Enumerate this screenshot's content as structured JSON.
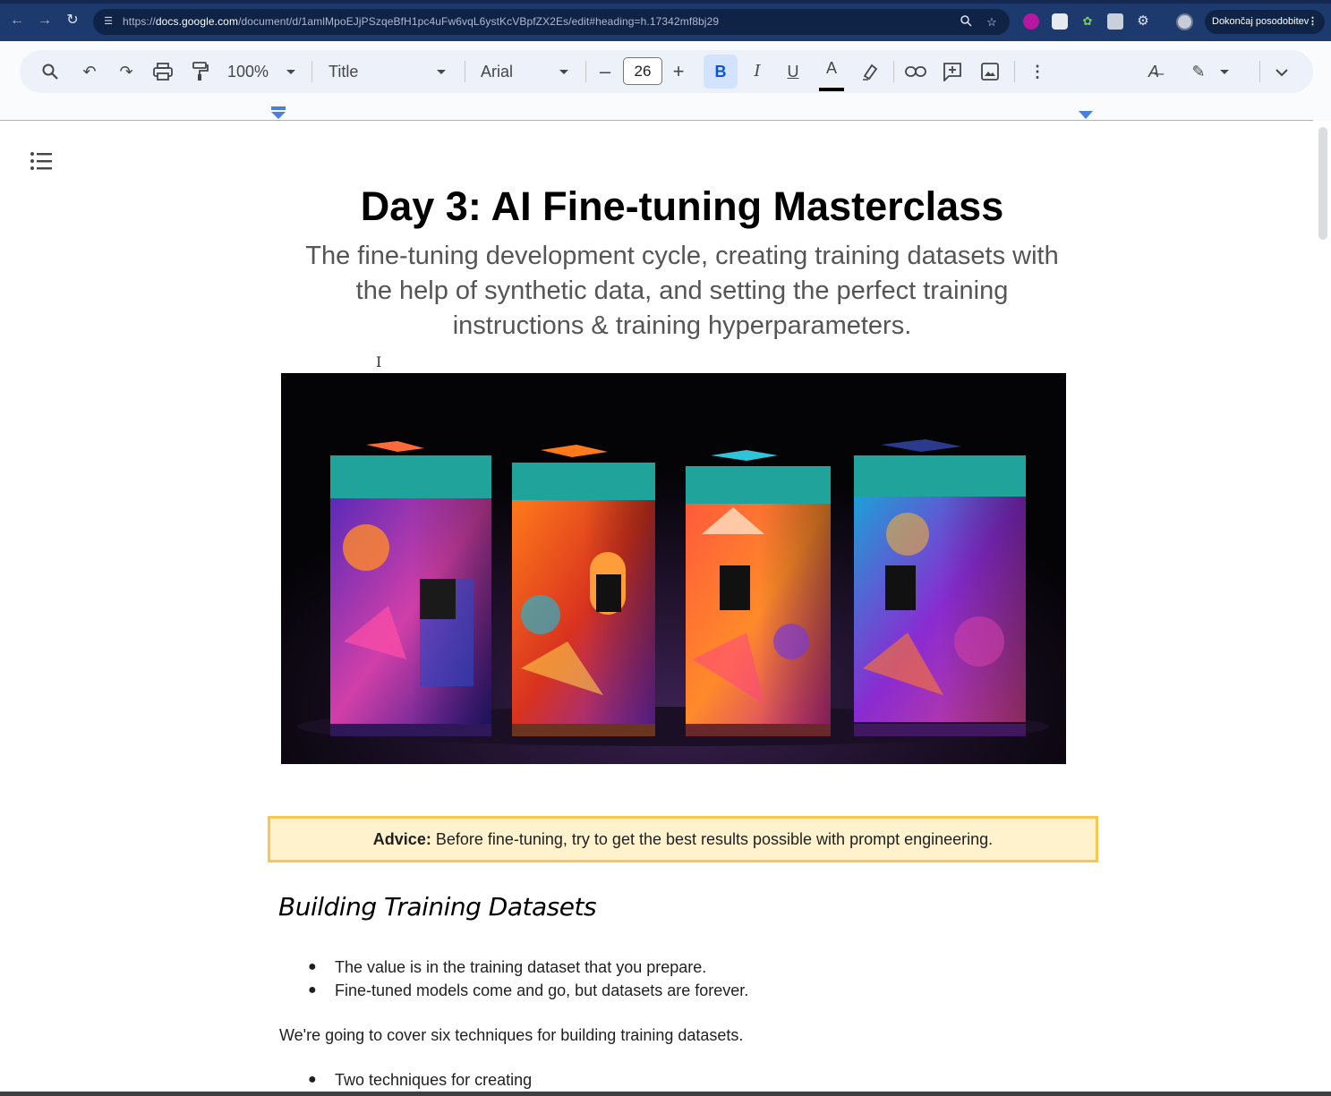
{
  "browser": {
    "url_prefix": "https://",
    "url_domain": "docs.google.com",
    "url_path": "/document/d/1amlMpoEJjPSzqeBfH1pc4uFw6vqL6ystKcVBpfZX2Es/edit#heading=h.17342mf8bj29",
    "update_label": "Dokončaj posodobitev",
    "icons": [
      "back-icon",
      "forward-icon",
      "reload-icon",
      "site-info-icon",
      "zoom-icon",
      "bookmark-star-icon",
      "extensions-icon",
      "profile-avatar",
      "more-icon"
    ]
  },
  "toolbar": {
    "zoom": "100%",
    "style": "Title",
    "font": "Arial",
    "font_size": "26",
    "bold": "B",
    "italic": "I",
    "underline": "U",
    "text_color_letter": "A",
    "active_format": "bold",
    "text_color": "#000000",
    "accent_color": "#0b57d0"
  },
  "document": {
    "title": "Day 3: AI Fine-tuning Masterclass",
    "subtitle": "The fine-tuning development cycle, creating training datasets with the help of synthetic data, and setting the perfect training instructions & training hyperparameters.",
    "advice_label": "Advice:",
    "advice_text": " Before fine-tuning, try to get the best results possible with prompt engineering.",
    "heading_building": "Building Training Datasets",
    "bullets_1": [
      "The value is in the training dataset that you prepare.",
      "Fine-tuned models come and go, but datasets are forever."
    ],
    "paragraph_1": "We're going to cover six techniques for building training datasets.",
    "bullets_2": [
      "Two techniques for creating"
    ],
    "advice_bg": "#fff2cc",
    "advice_border": "#f6c84f"
  }
}
